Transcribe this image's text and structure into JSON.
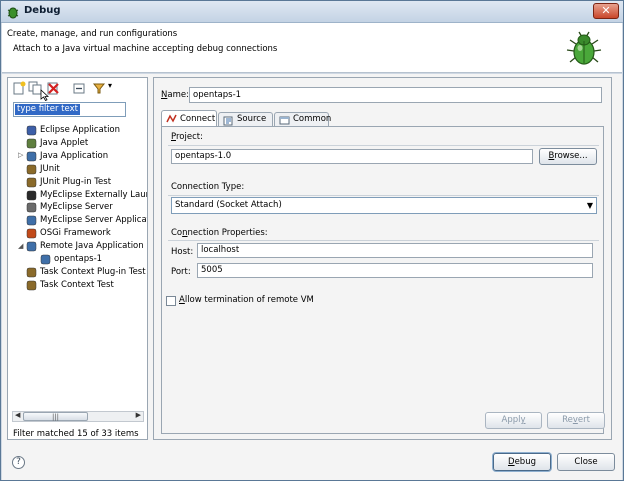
{
  "window": {
    "title": "Debug"
  },
  "header": {
    "title": "Create, manage, and run configurations",
    "description": "Attach to a Java virtual machine accepting debug connections"
  },
  "left": {
    "filter_value": "type filter text",
    "tree": [
      {
        "label": "Eclipse Application",
        "icon": "eclipse-icon",
        "color": "#3d5fa8"
      },
      {
        "label": "Java Applet",
        "icon": "applet-icon",
        "color": "#5f7f3f"
      },
      {
        "label": "Java Application",
        "icon": "java-app-icon",
        "color": "#3f6fa8"
      },
      {
        "label": "JUnit",
        "icon": "junit-icon",
        "color": "#8a6a2a"
      },
      {
        "label": "JUnit Plug-in Test",
        "icon": "junit-plugin-icon",
        "color": "#8a6a2a"
      },
      {
        "label": "MyEclipse Externally Launc",
        "icon": "external-launch-icon",
        "color": "#2a2a2a"
      },
      {
        "label": "MyEclipse Server",
        "icon": "server-icon",
        "color": "#6a6a6a"
      },
      {
        "label": "MyEclipse Server Applicati",
        "icon": "server-app-icon",
        "color": "#3f6fa8"
      },
      {
        "label": "OSGi Framework",
        "icon": "osgi-icon",
        "color": "#c24a1a"
      },
      {
        "label": "Remote Java Application",
        "icon": "remote-java-icon",
        "color": "#3f6fa8"
      },
      {
        "label": "opentaps-1",
        "icon": "config-icon",
        "color": "#3f6fa8"
      },
      {
        "label": "Task Context Plug-in Test",
        "icon": "task-plugin-icon",
        "color": "#8a6a2a"
      },
      {
        "label": "Task Context Test",
        "icon": "task-test-icon",
        "color": "#8a6a2a"
      }
    ],
    "scroll_thumb": "|||",
    "status": "Filter matched 15 of 33 items"
  },
  "right": {
    "name_label": "Name:",
    "name_value": "opentaps-1",
    "tabs": [
      {
        "label": "Connect",
        "icon": "connect-icon"
      },
      {
        "label": "Source",
        "icon": "source-icon"
      },
      {
        "label": "Common",
        "icon": "common-icon"
      }
    ],
    "project_label": "Project:",
    "project_value": "opentaps-1.0",
    "browse_label": "Browse...",
    "connection_type_label": "Connection Type:",
    "connection_type_value": "Standard (Socket Attach)",
    "connection_props_label": "Connection Properties:",
    "host_label": "Host:",
    "host_value": "localhost",
    "port_label": "Port:",
    "port_value": "5005",
    "allow_label": "Allow termination of remote VM",
    "apply_label": "Apply",
    "revert_label": "Revert"
  },
  "footer": {
    "help": "?",
    "debug_label": "Debug",
    "close_label": "Close"
  }
}
